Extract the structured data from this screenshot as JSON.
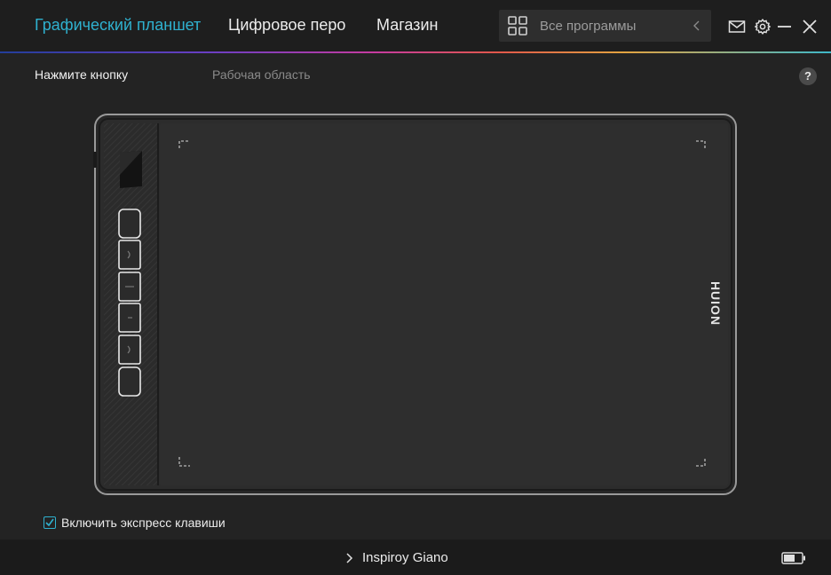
{
  "header": {
    "tabs": [
      {
        "label": "Графический планшет",
        "active": true
      },
      {
        "label": "Цифровое перо",
        "active": false
      },
      {
        "label": "Магазин",
        "active": false
      }
    ],
    "app_selector": {
      "label": "Все программы",
      "icon": "grid-icon"
    },
    "window_controls": [
      "mail-icon",
      "gear-icon",
      "minimize-icon",
      "close-icon"
    ]
  },
  "subtabs": {
    "press_button": "Нажмите кнопку",
    "work_area": "Рабочая область",
    "help": "?"
  },
  "tablet": {
    "brand": "HUION",
    "express_key_count": 6
  },
  "express_keys": {
    "checked": true,
    "label": "Включить экспресс клавиши"
  },
  "footer": {
    "device_name": "Inspiroy Giano",
    "battery_icon": "battery-icon"
  },
  "colors": {
    "accent": "#2fb1cf",
    "background": "#232323",
    "header": "#1e1e1e"
  }
}
